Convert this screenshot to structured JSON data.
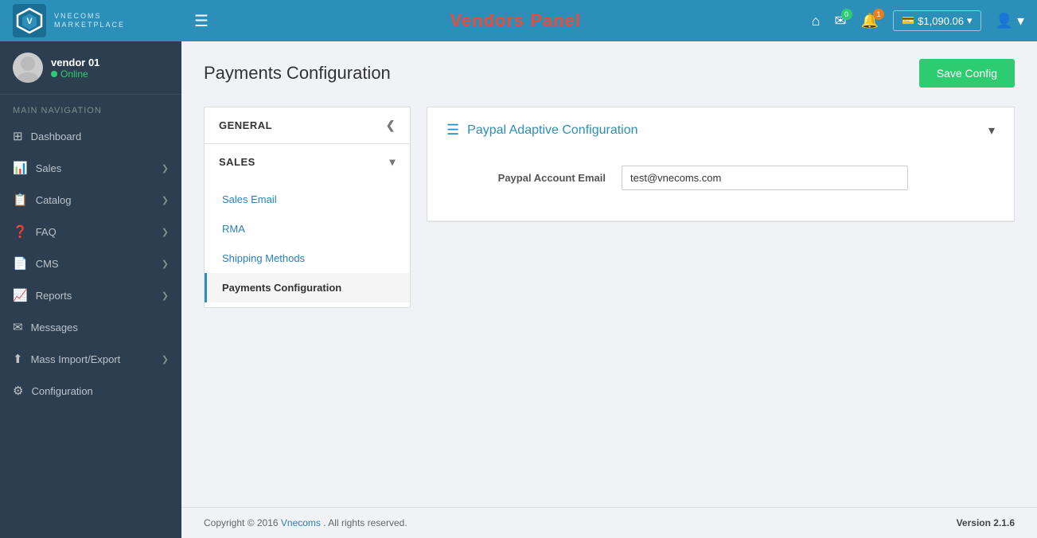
{
  "header": {
    "hamburger": "☰",
    "app_title": "Vendors Panel",
    "logo_name": "VNECOMS",
    "logo_sub": "MARKETPLACE",
    "icons": {
      "home": "⌂",
      "mail": "✉",
      "bell": "🔔",
      "mail_badge": "0",
      "bell_badge": "1",
      "balance": "$1,090.06",
      "user": "▾"
    }
  },
  "sidebar": {
    "username": "vendor 01",
    "status": "Online",
    "nav_label": "MAIN NAVIGATION",
    "items": [
      {
        "icon": "⊞",
        "label": "Dashboard",
        "has_arrow": false
      },
      {
        "icon": "📊",
        "label": "Sales",
        "has_arrow": true
      },
      {
        "icon": "📋",
        "label": "Catalog",
        "has_arrow": true
      },
      {
        "icon": "❓",
        "label": "FAQ",
        "has_arrow": true
      },
      {
        "icon": "📄",
        "label": "CMS",
        "has_arrow": true
      },
      {
        "icon": "📈",
        "label": "Reports",
        "has_arrow": true
      },
      {
        "icon": "✉",
        "label": "Messages",
        "has_arrow": false
      },
      {
        "icon": "⬆",
        "label": "Mass Import/Export",
        "has_arrow": true
      },
      {
        "icon": "⚙",
        "label": "Configuration",
        "has_arrow": false
      }
    ]
  },
  "content": {
    "page_title": "Payments Configuration",
    "save_button": "Save Config",
    "config_nav": {
      "sections": [
        {
          "label": "GENERAL",
          "collapsed": true,
          "arrow": "❮",
          "items": []
        },
        {
          "label": "SALES",
          "collapsed": false,
          "arrow": "▾",
          "items": [
            {
              "label": "Sales Email",
              "active": false
            },
            {
              "label": "RMA",
              "active": false
            },
            {
              "label": "Shipping Methods",
              "active": false
            },
            {
              "label": "Payments Configuration",
              "active": true
            }
          ]
        }
      ]
    },
    "paypal_section": {
      "title": "Paypal Adaptive Configuration",
      "chevron": "▾",
      "fields": [
        {
          "label": "Paypal Account Email",
          "value": "test@vnecoms.com",
          "placeholder": ""
        }
      ]
    }
  },
  "footer": {
    "copyright": "Copyright © 2016 ",
    "link_text": "Vnecoms",
    "suffix": ". All rights reserved.",
    "version_label": "Version",
    "version": "2.1.6"
  }
}
